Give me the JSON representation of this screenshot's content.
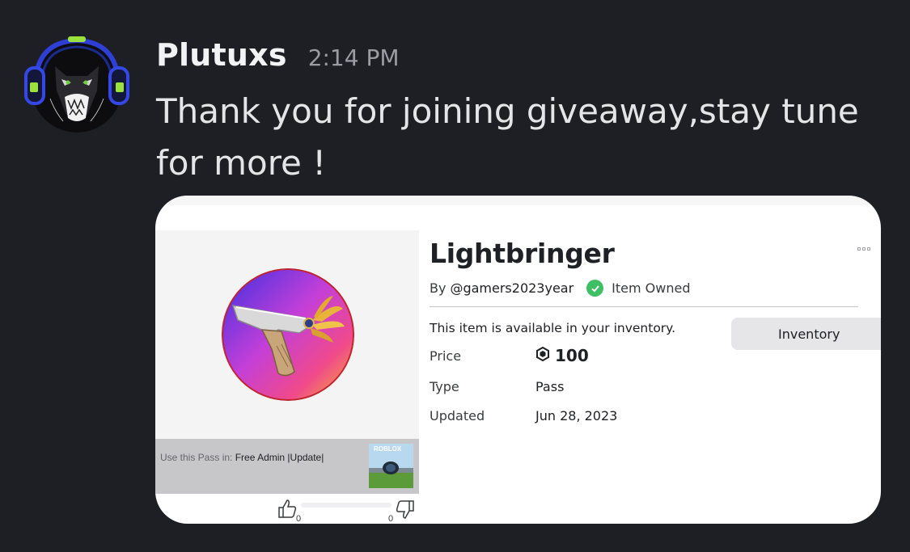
{
  "message": {
    "author": "Plutuxs",
    "timestamp": "2:14 PM",
    "text": "Thank you for joining giveaway,stay tune for more !"
  },
  "colors": {
    "background": "#1e1f24",
    "author": "#f2f3f5",
    "timestamp": "#9a9ca3",
    "owned_check": "#3fbf63"
  },
  "attachment": {
    "title": "Lightbringer",
    "creator_prefix": "By",
    "creator": "@gamers2023year",
    "owned_label": "Item Owned",
    "available_text": "This item is available in your inventory.",
    "inventory_button": "Inventory",
    "fields": {
      "price_label": "Price",
      "price_value": "100",
      "type_label": "Type",
      "type_value": "Pass",
      "updated_label": "Updated",
      "updated_value": "Jun 28, 2023"
    },
    "use_pass": {
      "prefix": "Use this Pass in:",
      "game": "Free Admin |Update|",
      "thumbnail_logo": "ROBLOX"
    },
    "votes": {
      "up": "0",
      "down": "0"
    }
  },
  "icons": [
    "avatar-panther-headphones",
    "more-options-icon",
    "checkmark-icon",
    "robux-icon",
    "thumbs-up-icon",
    "thumbs-down-icon",
    "gun-item-thumbnail"
  ]
}
